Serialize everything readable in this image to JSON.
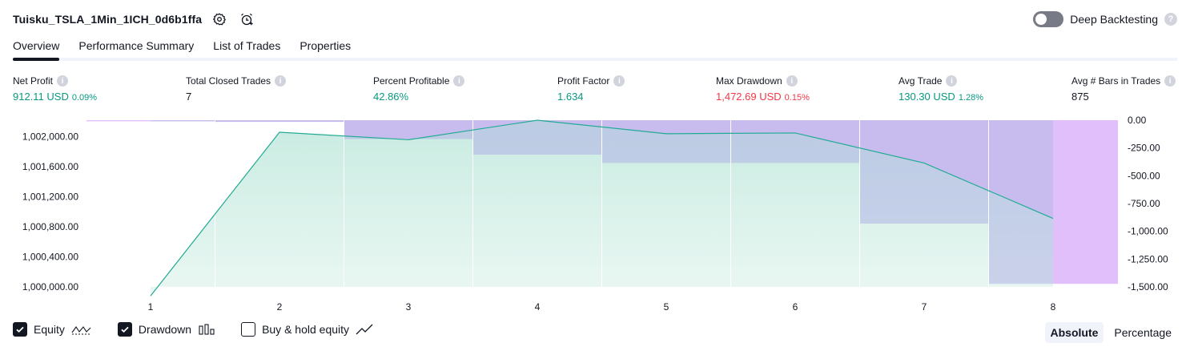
{
  "header": {
    "strategy_name": "Tuisku_TSLA_1Min_1ICH_0d6b1ffa",
    "settings_icon": "gear-icon",
    "alert_icon": "alarm-clock-plus-icon",
    "deep_backtesting_label": "Deep Backtesting",
    "deep_backtesting_enabled": false
  },
  "tabs": [
    {
      "label": "Overview",
      "active": true
    },
    {
      "label": "Performance Summary",
      "active": false
    },
    {
      "label": "List of Trades",
      "active": false
    },
    {
      "label": "Properties",
      "active": false
    }
  ],
  "metrics": [
    {
      "label": "Net Profit",
      "value": "912.11 USD",
      "pct": "0.09%",
      "color": "green"
    },
    {
      "label": "Total Closed Trades",
      "value": "7",
      "pct": "",
      "color": "dark"
    },
    {
      "label": "Percent Profitable",
      "value": "42.86%",
      "pct": "",
      "color": "green"
    },
    {
      "label": "Profit Factor",
      "value": "1.634",
      "pct": "",
      "color": "green"
    },
    {
      "label": "Max Drawdown",
      "value": "1,472.69 USD",
      "pct": "0.15%",
      "color": "red"
    },
    {
      "label": "Avg Trade",
      "value": "130.30 USD",
      "pct": "1.28%",
      "color": "green"
    },
    {
      "label": "Avg # Bars in Trades",
      "value": "875",
      "pct": "",
      "color": "dark"
    }
  ],
  "colors": {
    "green": "#089981",
    "red": "#f23645",
    "equity_line": "#22ab94",
    "equity_fill": "#c5ebe0",
    "drawdown_fill": "#e1bffb",
    "overlap_fill": "#b4b9e6"
  },
  "chart_data": {
    "type": "area",
    "x": [
      1,
      2,
      3,
      4,
      5,
      6,
      7,
      8
    ],
    "series": [
      {
        "name": "Equity",
        "axis": "left",
        "values": [
          999880,
          1002060,
          1001960,
          1002280,
          1002040,
          1002050,
          1001650,
          1000912
        ]
      },
      {
        "name": "Drawdown",
        "axis": "right",
        "values": [
          -10,
          -15,
          -170,
          -310,
          -385,
          -385,
          -930,
          -1472.69
        ]
      }
    ],
    "left_axis": {
      "ticks": [
        "1,000,000.00",
        "1,000,400.00",
        "1,000,800.00",
        "1,001,200.00",
        "1,001,600.00",
        "1,002,000.00"
      ],
      "values": [
        1000000,
        1000400,
        1000800,
        1001200,
        1001600,
        1002000
      ],
      "range": [
        1000000,
        1002220
      ]
    },
    "right_axis": {
      "ticks": [
        "0.00",
        "-250.00",
        "-500.00",
        "-750.00",
        "-1,000.00",
        "-1,250.00",
        "-1,500.00"
      ],
      "values": [
        0,
        -250,
        -500,
        -750,
        -1000,
        -1250,
        -1500
      ],
      "range": [
        -1500,
        0
      ]
    },
    "x_tick_labels": [
      "1",
      "2",
      "3",
      "4",
      "5",
      "6",
      "7",
      "8"
    ]
  },
  "legend": [
    {
      "label": "Equity",
      "checked": true,
      "icon": "equity-line-icon"
    },
    {
      "label": "Drawdown",
      "checked": true,
      "icon": "drawdown-bars-icon"
    },
    {
      "label": "Buy & hold equity",
      "checked": false,
      "icon": "buy-hold-line-icon"
    }
  ],
  "modes": [
    {
      "label": "Absolute",
      "active": true
    },
    {
      "label": "Percentage",
      "active": false
    }
  ]
}
